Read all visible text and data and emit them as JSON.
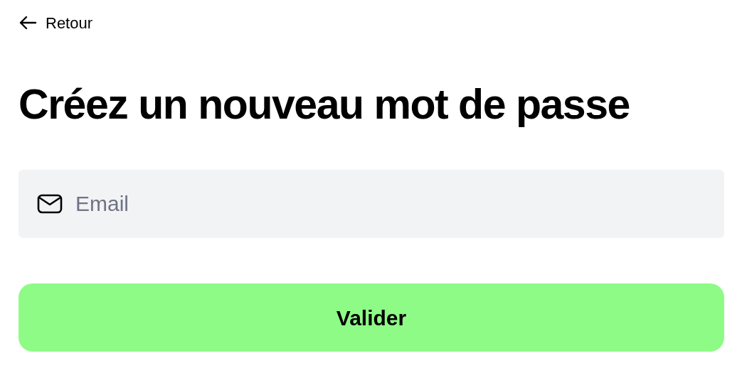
{
  "back_link": {
    "label": "Retour"
  },
  "heading": "Créez un nouveau mot de passe",
  "email_field": {
    "placeholder": "Email"
  },
  "submit_button": {
    "label": "Valider"
  }
}
